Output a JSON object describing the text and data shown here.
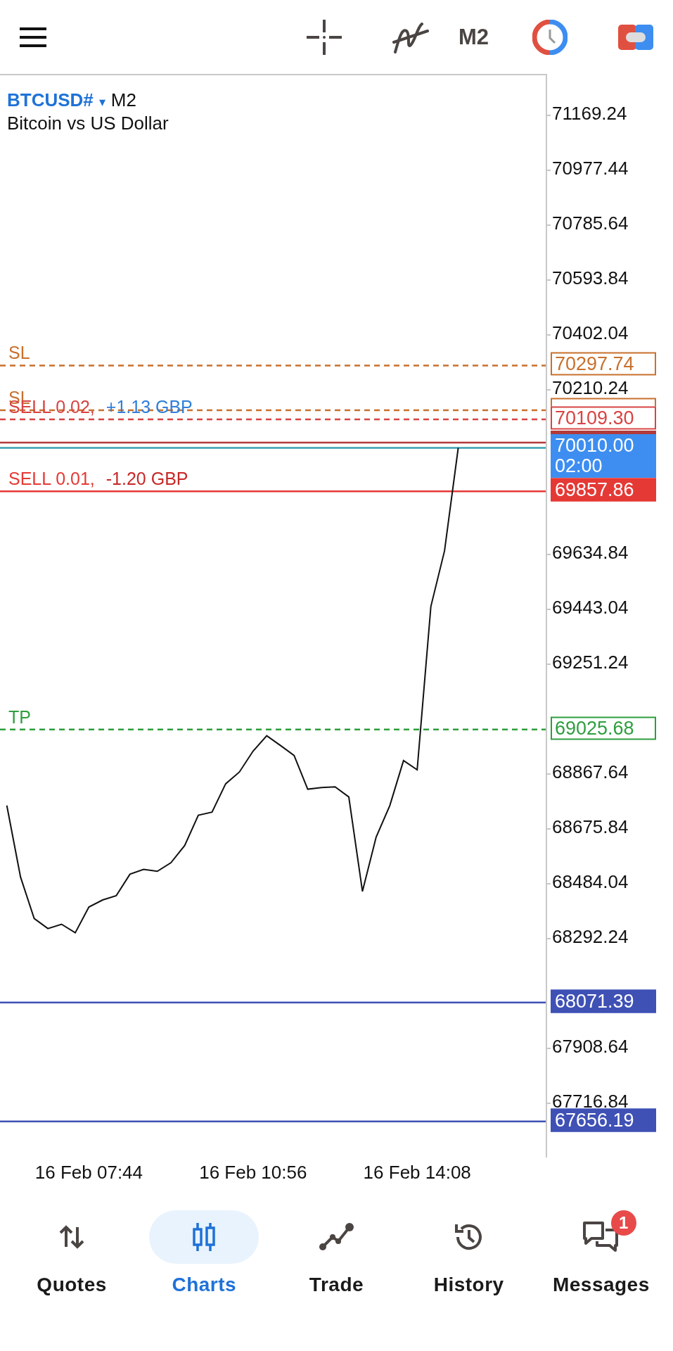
{
  "toolbar": {
    "timeframe": "M2"
  },
  "chart": {
    "symbol": "BTCUSD#",
    "dropdown": "▾",
    "period": "M2",
    "description": "Bitcoin vs US Dollar",
    "chart_data": {
      "type": "line",
      "ylim": [
        67525,
        71312
      ],
      "categories": [
        null,
        null,
        null,
        null,
        null,
        null,
        "16 Feb 07:44",
        null,
        null,
        null,
        null,
        null,
        null,
        null,
        null,
        null,
        null,
        null,
        "16 Feb 10:56",
        null,
        null,
        null,
        null,
        null,
        null,
        null,
        null,
        null,
        null,
        null,
        "16 Feb 14:08",
        null,
        null,
        null,
        null,
        null,
        null,
        null,
        null,
        null
      ],
      "ref_lines": [
        {
          "axis": "y",
          "value": 70297.74,
          "color": "#c8702c"
        },
        {
          "axis": "y",
          "value": 70141.18,
          "color": "#c8702c"
        },
        {
          "axis": "y",
          "value": 70109.3,
          "color": "#d84343"
        },
        {
          "axis": "y",
          "value": 70010.0,
          "color": "#3aa0b0"
        },
        {
          "axis": "y",
          "value": 69857.86,
          "color": "#e53935"
        },
        {
          "axis": "y",
          "value": 69025.68,
          "color": "#2e9e3e"
        },
        {
          "axis": "y",
          "value": 68071.39,
          "color": "#3f51b5"
        },
        {
          "axis": "y",
          "value": 67656.19,
          "color": "#3f51b5"
        },
        {
          "axis": "y",
          "value": 70028.5,
          "color": "#b23a3a"
        }
      ],
      "series": [
        {
          "color": "#111111",
          "values": [
            68760,
            68510,
            68365,
            68330,
            68345,
            68315,
            68405,
            68430,
            68445,
            68520,
            68537,
            68530,
            68560,
            68620,
            68726,
            68737,
            68836,
            68877,
            68950,
            69004,
            68970,
            68935,
            68817,
            68823,
            68825,
            68790,
            68460,
            68650,
            68760,
            68917,
            68885,
            69456,
            69650,
            70010,
            null,
            null,
            null,
            null,
            null,
            null
          ]
        }
      ],
      "yticks": [
        {
          "value": 71169.24,
          "label": "71169.24"
        },
        {
          "value": 70977.44,
          "label": "70977.44"
        },
        {
          "value": 70785.64,
          "label": "70785.64"
        },
        {
          "value": 70593.84,
          "label": "70593.84"
        },
        {
          "value": 70402.04,
          "label": "70402.04"
        },
        {
          "value": 70210.24,
          "label": "70210.24"
        },
        {
          "value": 69634.84,
          "label": "69634.84"
        },
        {
          "value": 69443.04,
          "label": "69443.04"
        },
        {
          "value": 69251.24,
          "label": "69251.24"
        },
        {
          "value": 68867.64,
          "label": "68867.64"
        },
        {
          "value": 68675.84,
          "label": "68675.84"
        },
        {
          "value": 68484.04,
          "label": "68484.04"
        },
        {
          "value": 68292.24,
          "label": "68292.24"
        },
        {
          "value": 67908.64,
          "label": "67908.64"
        },
        {
          "value": 67716.84,
          "label": "67716.84"
        }
      ]
    },
    "levels": [
      {
        "kind": "stop_loss",
        "label": "SL",
        "price": "70297.74"
      },
      {
        "kind": "stop_loss",
        "label": "SL"
      },
      {
        "kind": "sell_order",
        "label": "SELL 0.02,",
        "pnl": {
          "text": "+1.13 GBP",
          "color": "#2f7fd8"
        },
        "price": "70109.30"
      },
      {
        "kind": "bid",
        "price": "70010.00",
        "countdown": "02:00"
      },
      {
        "kind": "sell_position",
        "label": "SELL 0.01,",
        "pnl": {
          "text": "-1.20 GBP",
          "color": "#c62828"
        },
        "price": "69857.86"
      },
      {
        "kind": "take_profit",
        "label": "TP",
        "price": "69025.68"
      },
      {
        "kind": "alert",
        "price": "68071.39"
      },
      {
        "kind": "alert",
        "price": "67656.19"
      }
    ]
  },
  "nav": [
    {
      "kind": "quotes",
      "label": "Quotes",
      "selected": false
    },
    {
      "kind": "charts",
      "label": "Charts",
      "selected": true
    },
    {
      "kind": "trade",
      "label": "Trade",
      "selected": false
    },
    {
      "kind": "history",
      "label": "History",
      "selected": false
    },
    {
      "kind": "messages",
      "label": "Messages",
      "selected": false,
      "badge": "1"
    }
  ]
}
